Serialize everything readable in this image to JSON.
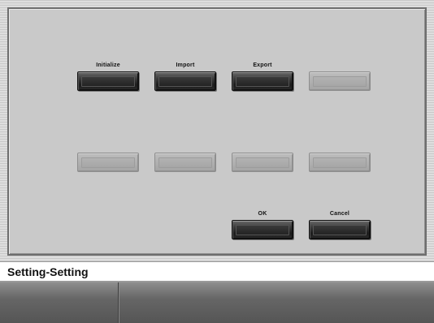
{
  "buttons": {
    "initialize": "Initialize",
    "import": "Import",
    "export": "Export",
    "ok": "OK",
    "cancel": "Cancel"
  },
  "footer": {
    "title": "Setting-Setting"
  },
  "colors": {
    "active_button": "#2a2a2a",
    "disabled_button": "#a8a8a8",
    "panel_background": "#c9c9c9"
  }
}
